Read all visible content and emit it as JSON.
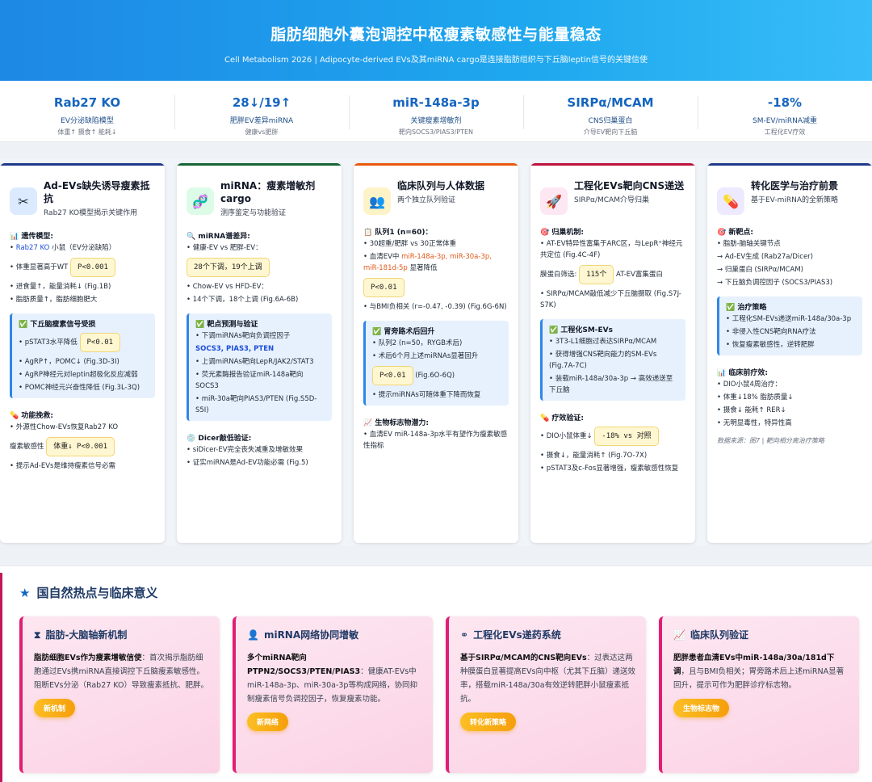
{
  "header": {
    "title": "脂肪细胞外囊泡调控中枢瘦素敏感性与能量稳态",
    "subtitle": "Cell Metabolism 2026 | Adipocyte-derived EVs及其miRNA cargo是连接脂肪组织与下丘脑leptin信号的关键信使"
  },
  "stats": [
    {
      "big": "Rab27 KO",
      "label": "EV分泌缺陷模型",
      "small": "体重↑ 摄食↑ 能耗↓"
    },
    {
      "big": "28↓/19↑",
      "label": "肥胖EV差异miRNA",
      "small": "健康vs肥胖"
    },
    {
      "big": "miR-148a-3p",
      "label": "关键瘦素增敏剂",
      "small": "靶向SOCS3/PIAS3/PTEN"
    },
    {
      "big": "SIRPα/MCAM",
      "label": "CNS归巢蛋白",
      "small": "介导EV靶向下丘脑"
    },
    {
      "big": "-18%",
      "label": "SM-EV/miRNA减重",
      "small": "工程化EV疗效"
    }
  ],
  "cards": {
    "c1": {
      "title": "Ad-EVs缺失诱导瘦素抵抗",
      "sub": "Rab27 KO模型揭示关键作用",
      "s1": "遗传模型:",
      "l1a": "Rab27 KO",
      "l1b": " 小鼠（EV分泌缺陷）",
      "l2": "体重显著高于WT",
      "p1": "P<0.001",
      "l3": "进食量↑，能量消耗↓ (Fig.1B)",
      "l4": "脂肪质量↑，脂肪细胞肥大",
      "s2": "下丘脑瘦素信号受损",
      "l5": "pSTAT3水平降低",
      "p2": "P<0.01",
      "l6": "AgRP↑，POMC↓ (Fig.3D-3I)",
      "l7": "AgRP神经元对leptin超极化反应减弱",
      "l8": "POMC神经元兴奋性降低 (Fig.3L-3Q)",
      "s3": "功能挽救:",
      "l9": "外源性Chow-EVs恢复Rab27 KO",
      "l10": "瘦素敏感性",
      "p3": "体重↓ P<0.001",
      "l11": "提示Ad-EVs是维持瘦素信号必需"
    },
    "c2": {
      "title": "miRNA：瘦素增敏剂cargo",
      "sub": "测序鉴定与功能验证",
      "s1": "miRNA谱差异:",
      "l1": "健康-EV vs 肥胖-EV：",
      "p1": "28个下调，19个上调",
      "l2": "Chow-EV vs HFD-EV：",
      "l3": "14个下调，18个上调 (Fig.6A-6B)",
      "s2": "靶点预测与验证",
      "l4": "下调miRNAs靶向负调控因子",
      "l5": "SOCS3, PIAS3, PTEN",
      "l6": "上调miRNAs靶向LepR/JAK2/STAT3",
      "l7": "荧光素酶报告验证miR-148a靶向SOCS3",
      "l8": "miR-30a靶向PIAS3/PTEN (Fig.S5D-S5I)",
      "s3": "Dicer敲低验证:",
      "l9": "siDicer-EV完全丧失减重及增敏效果",
      "l10": "证实miRNA是Ad-EV功能必需 (Fig.5)"
    },
    "c3": {
      "title": "临床队列与人体数据",
      "sub": "两个独立队列验证",
      "s1": "队列1 (n=60)：",
      "l1": "30超重/肥胖 vs 30正常体重",
      "l2a": "血清EV中 ",
      "l2b": "miR-148a-3p, miR-30a-3p,",
      "l2c": "miR-181d-5p",
      "l2d": " 显著降低",
      "p1": "P<0.01",
      "l3": "与BMI负相关 (r=-0.47, -0.39) (Fig.6G-6N)",
      "s2": "胃旁路术后回升",
      "l4": "队列2 (n=50，RYGB术后)",
      "l5": "术后6个月上述miRNAs显著回升",
      "p2": "P<0.01",
      "p2note": "(Fig.6O-6Q)",
      "l6": "提示miRNAs可随体重下降而恢复",
      "s3": "生物标志物潜力:",
      "l7": "血清EV miR-148a-3p水平有望作为瘦素敏感性指标"
    },
    "c4": {
      "title": "工程化EVs靶向CNS递送",
      "sub": "SIRPα/MCAM介导归巢",
      "s1": "归巢机制:",
      "l1": "AT-EV特异性富集于ARC区，与LepR⁺神经元共定位 (Fig.4C-4F)",
      "l2a": "膜蛋白筛选:",
      "p1": "115个",
      "l2b": "AT-EV富集蛋白",
      "l3": "SIRPα/MCAM敲低减少下丘脑摄取 (Fig.S7J-S7K)",
      "s2": "工程化SM-EVs",
      "l4": "3T3-L1细胞过表达SIRPα/MCAM",
      "l5": "获得增强CNS靶向能力的SM-EVs (Fig.7A-7C)",
      "l6": "装载miR-148a/30a-3p → 高效递送至下丘脑",
      "s3": "疗效验证:",
      "l7": "DIO小鼠体重↓",
      "p2": "-18% vs 对照",
      "l8": "摄食↓，能量消耗↑ (Fig.7O-7X)",
      "l9": "pSTAT3及c-Fos显著增强，瘦素敏感性恢复"
    },
    "c5": {
      "title": "转化医学与治疗前景",
      "sub": "基于EV-miRNA的全新策略",
      "s1": "新靶点:",
      "l1": "脂肪-脑轴关键节点",
      "l2": "→ Ad-EV生成 (Rab27a/Dicer)",
      "l3": "→ 归巢蛋白 (SIRPα/MCAM)",
      "l4": "→ 下丘脑负调控因子 (SOCS3/PIAS3)",
      "s2": "治疗策略",
      "l5": "工程化SM-EVs递送miR-148a/30a-3p",
      "l6": "非侵入性CNS靶向RNA疗法",
      "l7": "恢复瘦素敏感性，逆转肥胖",
      "s3": "临床前疗效:",
      "l8": "DIO小鼠4周治疗：",
      "l9": "体重↓18% 脂肪质量↓",
      "l10": "摄食↓ 能耗↑ RER↓",
      "l11": "无明显毒性，特异性高",
      "source": "数据来源：图7 | 靶向相分离治疗策略"
    }
  },
  "bottom": {
    "title": "国自然热点与临床意义",
    "items": [
      {
        "title": "脂肪-大脑轴新机制",
        "bold": "脂肪细胞EVs作为瘦素增敏信使",
        "text": "：首次揭示脂肪细胞通过EVs携miRNA直接调控下丘脑瘦素敏感性。阻断EVs分泌（Rab27 KO）导致瘦素抵抗、肥胖。",
        "tag": "新机制"
      },
      {
        "title": "miRNA网络协同增敏",
        "bold": "多个miRNA靶向PTPN2/SOCS3/PTEN/PIAS3",
        "text": "：健康AT-EVs中miR-148a-3p、miR-30a-3p等构成网络，协同抑制瘦素信号负调控因子，恢复瘦素功能。",
        "tag": "新网络"
      },
      {
        "title": "工程化EVs递药系统",
        "bold": "基于SIRPα/MCAM的CNS靶向EVs",
        "text": "：过表达这两种膜蛋白显著提高EVs向中枢（尤其下丘脑）递送效率，搭载miR-148a/30a有效逆转肥胖小鼠瘦素抵抗。",
        "tag": "转化新策略"
      },
      {
        "title": "临床队列验证",
        "bold": "肥胖患者血清EVs中miR-148a/30a/181d下调",
        "text": "，且与BMI负相关；胃旁路术后上述miRNA显著回升，提示可作为肥胖诊疗标志物。",
        "tag": "生物标志物"
      }
    ]
  },
  "colors": {
    "accent": "#1e88e5",
    "pink": "#e11d74",
    "highlight": "#fff7d1"
  }
}
